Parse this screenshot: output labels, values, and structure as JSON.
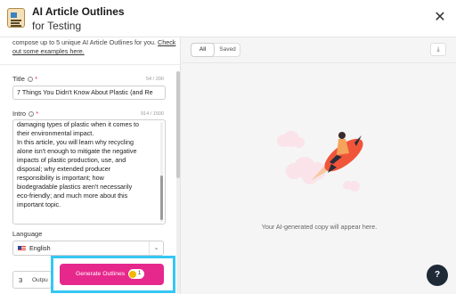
{
  "header": {
    "title": "AI Article Outlines",
    "subtitle": "for Testing",
    "close_icon": "close-icon"
  },
  "left_panel": {
    "description": "compose up to 5 unique AI Article Outlines for you.",
    "examples_link": "Check out some examples here.",
    "title_field": {
      "label": "Title",
      "required_mark": "*",
      "counter": "54 / 200",
      "value": "7 Things You Didn't Know About Plastic (and Re"
    },
    "intro_field": {
      "label": "Intro",
      "required_mark": "*",
      "counter": "914 / 1500",
      "value": "damaging types of plastic when it comes to\ntheir environmental impact.\nIn this article, you will learn why recycling\nalone isn't enough to mitigate the negative\nimpacts of plastic production, use, and\ndisposal; why extended producer\nresponsibility is important; how\nbiodegradable plastics aren't necessarily\neco-friendly; and much more about this\nimportant topic."
    },
    "language_field": {
      "label": "Language",
      "selected": "English"
    },
    "outputs_field": {
      "value": "3",
      "label": "Outpu"
    },
    "generate_button": {
      "label": "Generate Outlines",
      "credits": "1"
    }
  },
  "right_panel": {
    "tabs": [
      {
        "label": "All",
        "active": true
      },
      {
        "label": "Saved",
        "active": false
      }
    ],
    "download_icon": "download-icon",
    "empty_message": "Your AI-generated copy will appear here.",
    "help_label": "?"
  },
  "colors": {
    "accent": "#e6288d",
    "highlight": "#35c7f3",
    "help_bg": "#1f2a37"
  }
}
